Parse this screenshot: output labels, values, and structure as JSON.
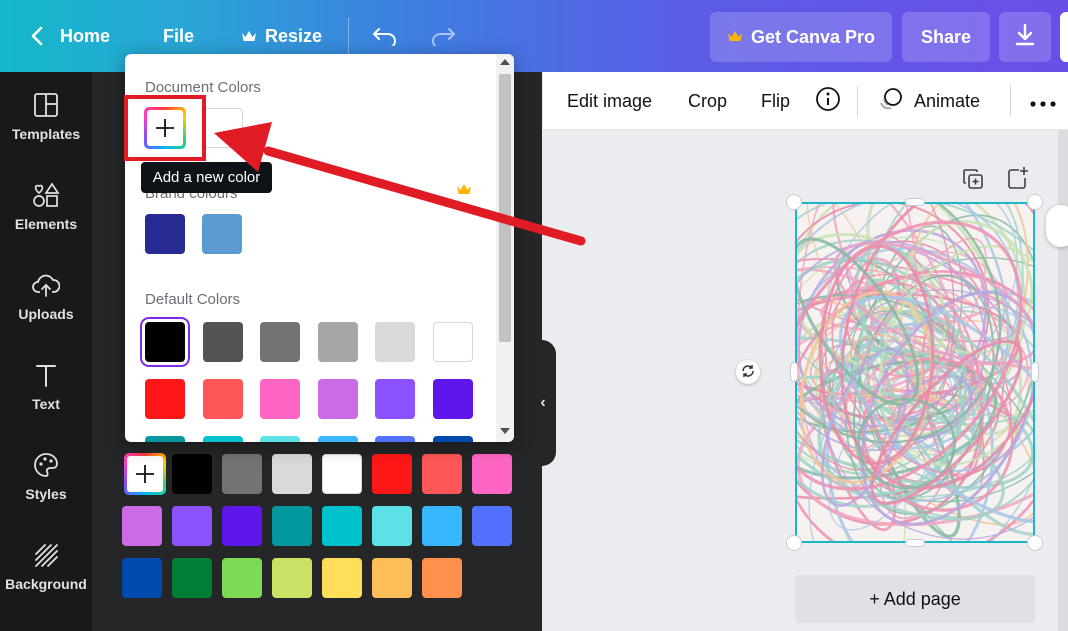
{
  "topbar": {
    "home_label": "Home",
    "file_label": "File",
    "resize_label": "Resize",
    "pro_label": "Get Canva Pro",
    "share_label": "Share"
  },
  "rail": {
    "items": [
      {
        "label": "Templates",
        "icon": "templates-icon"
      },
      {
        "label": "Elements",
        "icon": "elements-icon"
      },
      {
        "label": "Uploads",
        "icon": "uploads-icon"
      },
      {
        "label": "Text",
        "icon": "text-icon"
      },
      {
        "label": "Styles",
        "icon": "styles-icon"
      },
      {
        "label": "Background",
        "icon": "background-icon"
      }
    ]
  },
  "context_toolbar": {
    "edit_image_label": "Edit image",
    "crop_label": "Crop",
    "flip_label": "Flip",
    "animate_label": "Animate"
  },
  "color_picker": {
    "document_colors_heading": "Document Colors",
    "brand_colours_heading": "Brand colours",
    "default_colors_heading": "Default Colors",
    "tooltip": "Add a new color",
    "document_colors": [
      "#ffffff"
    ],
    "brand_colors": [
      "#272a93",
      "#5b9bd1"
    ],
    "default_colors_rows": [
      [
        "#000000",
        "#545454",
        "#737373",
        "#a6a6a6",
        "#d9d9d9",
        "#ffffff"
      ],
      [
        "#ff1616",
        "#ff5757",
        "#ff66c4",
        "#cb6ce6",
        "#8c52ff",
        "#5e17eb"
      ],
      [
        "#03989e",
        "#00c2cb",
        "#5ce1e6",
        "#38b6ff",
        "#5271ff",
        "#004aad"
      ]
    ]
  },
  "panel_swatches": {
    "rows": [
      [
        "#000000",
        "#737373",
        "#d9d9d9",
        "#ffffff",
        "#ff1616",
        "#ff5757",
        "#ff66c4"
      ],
      [
        "#cb6ce6",
        "#8c52ff",
        "#5e17eb",
        "#03989e",
        "#00c2cb",
        "#5ce1e6",
        "#38b6ff",
        "#5271ff"
      ],
      [
        "#004aad",
        "#008037",
        "#7ed957",
        "#c9e265",
        "#ffde59",
        "#ffbd59",
        "#ff914d"
      ]
    ]
  },
  "canvas": {
    "add_page_label": "+ Add page"
  },
  "colors": {
    "accent": "#7d2ae8",
    "annotation_red": "#e01b24",
    "selection": "#19b7c9",
    "crown": "#ffb400"
  }
}
